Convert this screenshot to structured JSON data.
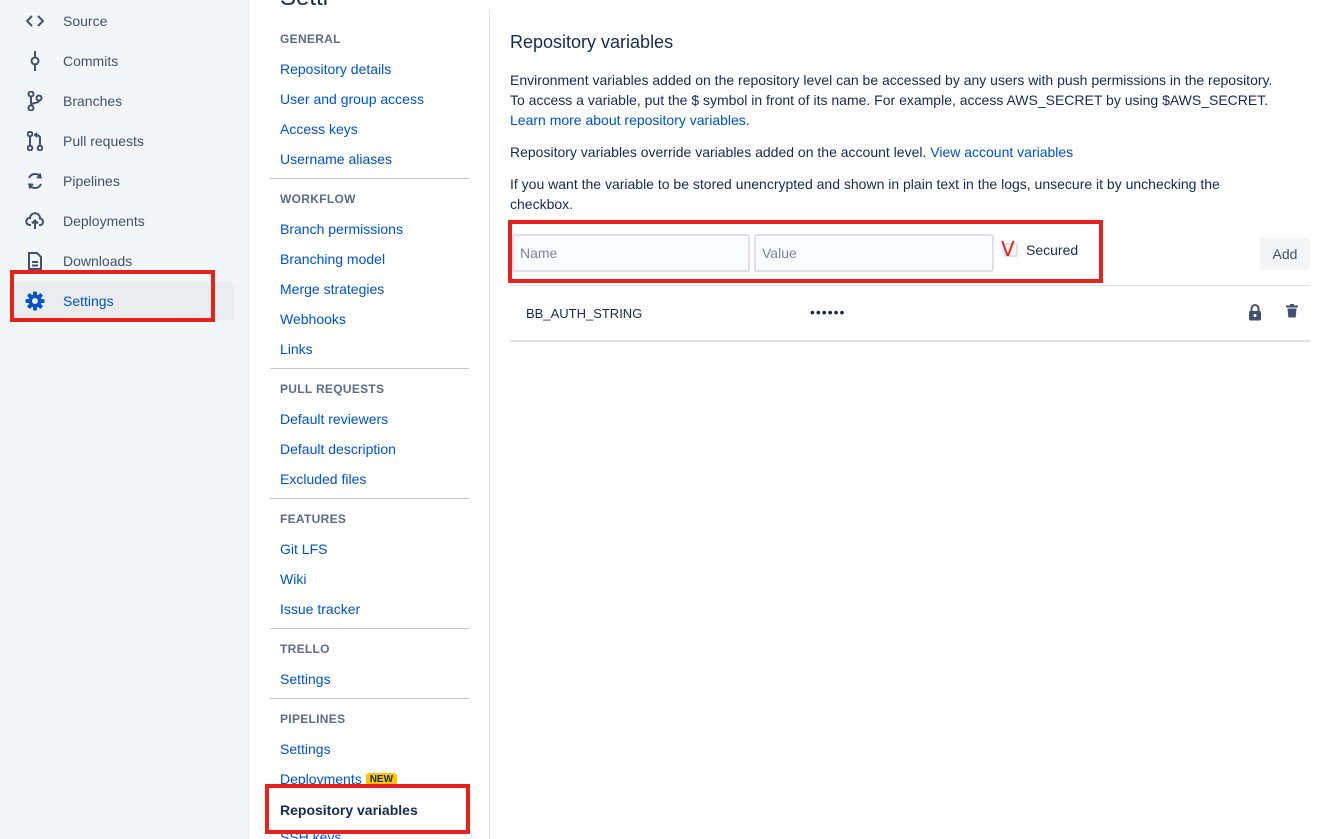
{
  "sidebar": {
    "items": [
      {
        "label": "Source",
        "icon": "source-code-icon"
      },
      {
        "label": "Commits",
        "icon": "commit-icon"
      },
      {
        "label": "Branches",
        "icon": "branch-icon"
      },
      {
        "label": "Pull requests",
        "icon": "pull-request-icon"
      },
      {
        "label": "Pipelines",
        "icon": "pipelines-icon"
      },
      {
        "label": "Deployments",
        "icon": "cloud-upload-icon"
      },
      {
        "label": "Downloads",
        "icon": "document-icon"
      },
      {
        "label": "Settings",
        "icon": "gear-icon",
        "active": true
      }
    ]
  },
  "settings_nav": {
    "sections": [
      {
        "heading": "GENERAL",
        "links": [
          "Repository details",
          "User and group access",
          "Access keys",
          "Username aliases"
        ]
      },
      {
        "heading": "WORKFLOW",
        "links": [
          "Branch permissions",
          "Branching model",
          "Merge strategies",
          "Webhooks",
          "Links"
        ]
      },
      {
        "heading": "PULL REQUESTS",
        "links": [
          "Default reviewers",
          "Default description",
          "Excluded files"
        ]
      },
      {
        "heading": "FEATURES",
        "links": [
          "Git LFS",
          "Wiki",
          "Issue tracker"
        ]
      },
      {
        "heading": "TRELLO",
        "links": [
          "Settings"
        ]
      },
      {
        "heading": "PIPELINES",
        "links": [
          "Settings",
          "Deployments",
          "Repository variables",
          "SSH keys"
        ]
      }
    ],
    "new_badge": "NEW"
  },
  "main": {
    "title": "Repository variables",
    "intro_line1": "Environment variables added on the repository level can be accessed by any users with push permissions in the repository.",
    "intro_line2": "To access a variable, put the $ symbol in front of its name. For example, access AWS_SECRET by using $AWS_SECRET.",
    "learn_more": "Learn more about repository variables",
    "learn_more_suffix": ".",
    "override_text": "Repository variables override variables added on the account level. ",
    "view_account": "View account variables",
    "unsecure_text": "If you want the variable to be stored unencrypted and shown in plain text in the logs, unsecure it by unchecking the checkbox.",
    "form": {
      "name_placeholder": "Name",
      "value_placeholder": "Value",
      "secured_label": "Secured",
      "secured_checked": true,
      "add_label": "Add"
    },
    "variables": [
      {
        "name": "BB_AUTH_STRING",
        "value": "••••••",
        "secured": true
      }
    ]
  },
  "colors": {
    "link": "#0052cc",
    "text": "#172b4d",
    "highlight": "#e5221b",
    "badge": "#ffc400"
  }
}
